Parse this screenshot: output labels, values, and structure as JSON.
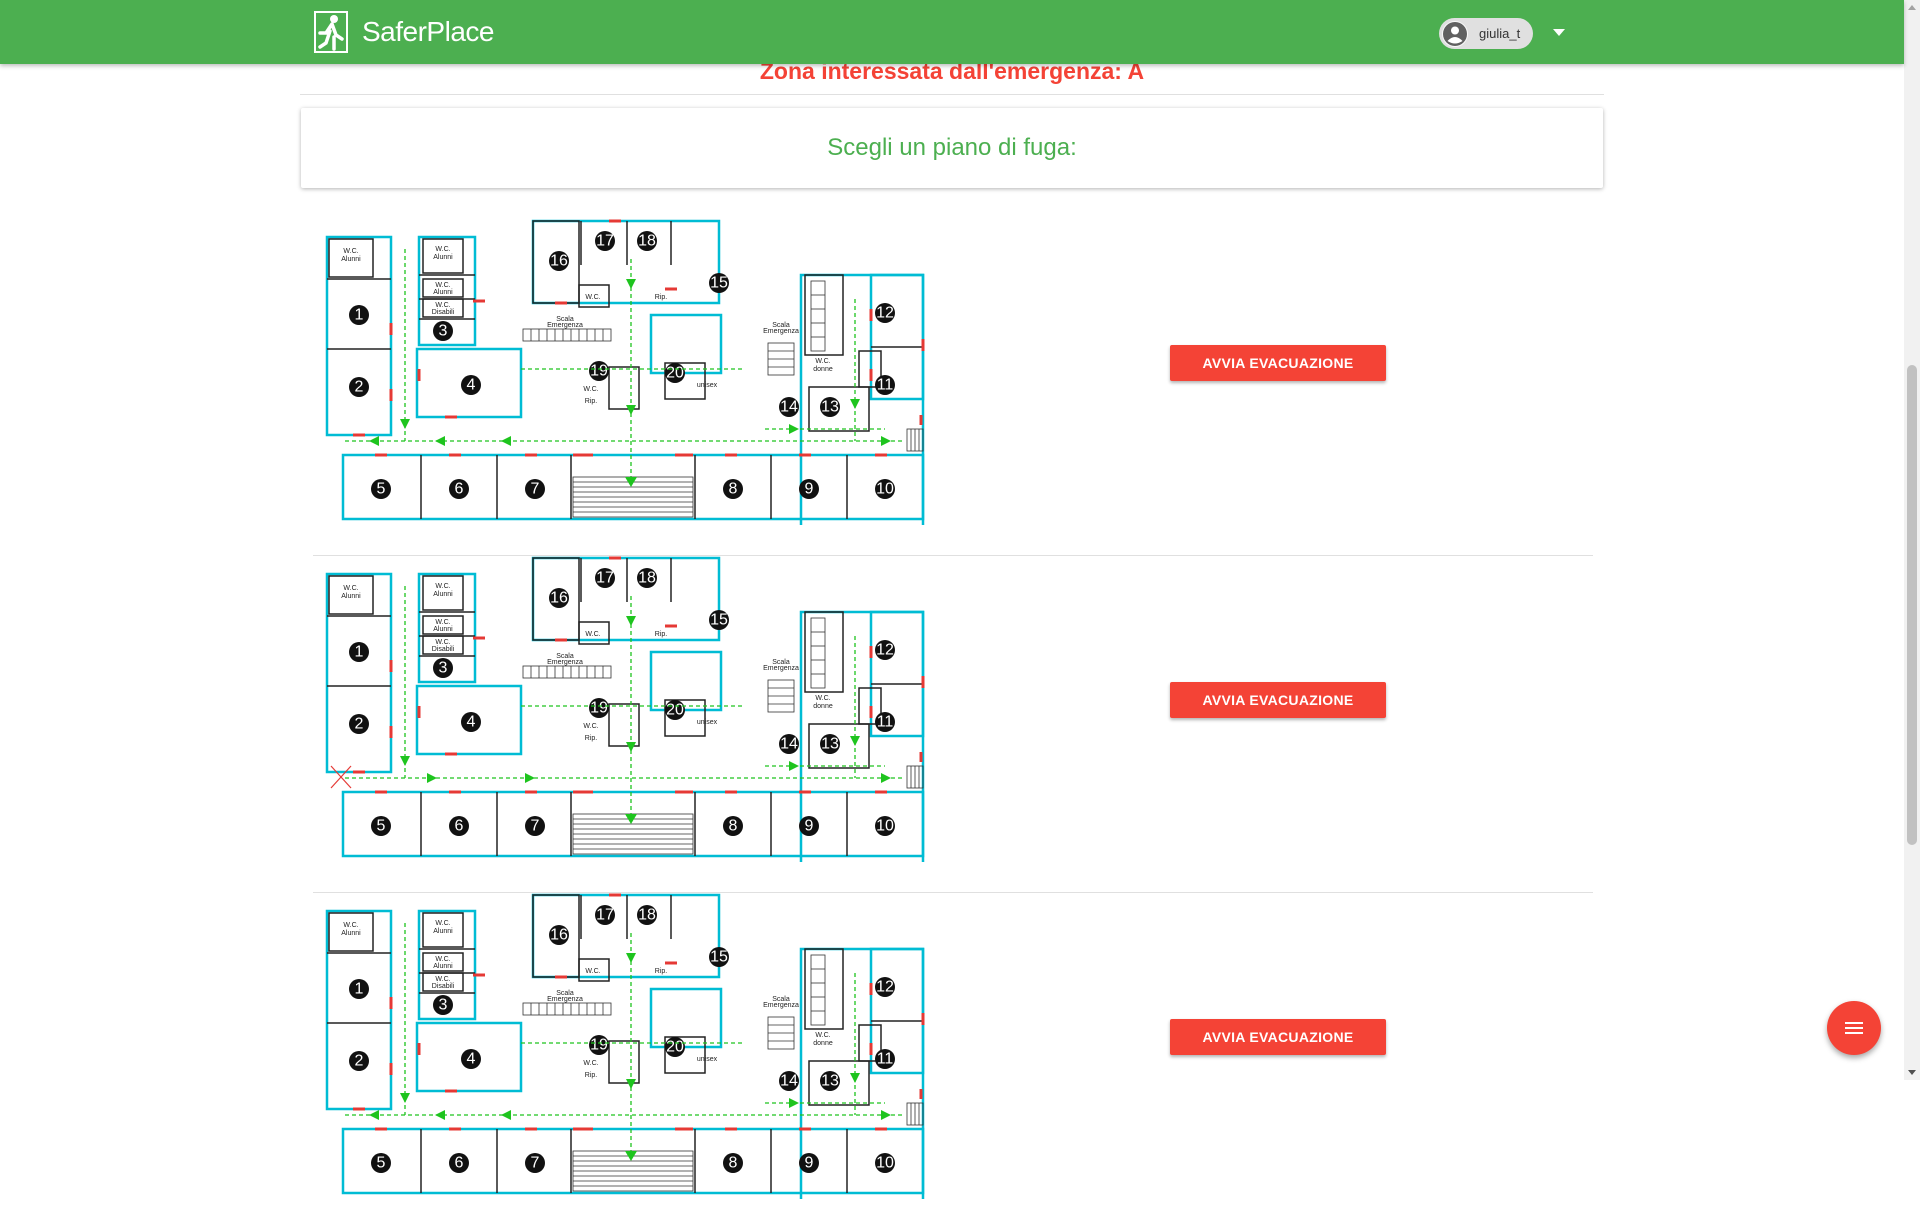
{
  "app": {
    "brand": "SaferPlace"
  },
  "user": {
    "name": "giulia_t"
  },
  "emergency": {
    "title": "Zona interessata dall'emergenza: A"
  },
  "card": {
    "title": "Scegli un piano di fuga:"
  },
  "plans": [
    {
      "button_label": "AVVIA EVACUAZIONE"
    },
    {
      "button_label": "AVVIA EVACUAZIONE"
    },
    {
      "button_label": "AVVIA EVACUAZIONE"
    }
  ],
  "floorplan": {
    "room_numbers": [
      "1",
      "2",
      "3",
      "4",
      "5",
      "6",
      "7",
      "8",
      "9",
      "10",
      "11",
      "12",
      "13",
      "14",
      "15",
      "16",
      "17",
      "18",
      "19",
      "20"
    ],
    "labels": {
      "wc_alunni": "W.C. Alunni",
      "wc_disabili": "W.C. Disabili",
      "scala_emergenza": "Scala Emergenza",
      "rip": "Rip.",
      "wc": "W.C.",
      "wc_donne": "WC donne"
    }
  },
  "colors": {
    "topbar": "#4caf50",
    "emergency_text": "#f44336",
    "card_title": "#4caf50",
    "button": "#f44336",
    "plan_wall": "#00bcd4",
    "plan_door": "#e53935",
    "plan_route": "#1ec41e"
  },
  "icons": {
    "logo": "emergency-exit-icon",
    "avatar": "account-circle-icon",
    "menu_caret": "arrow-drop-down-icon",
    "fab": "menu-icon"
  }
}
